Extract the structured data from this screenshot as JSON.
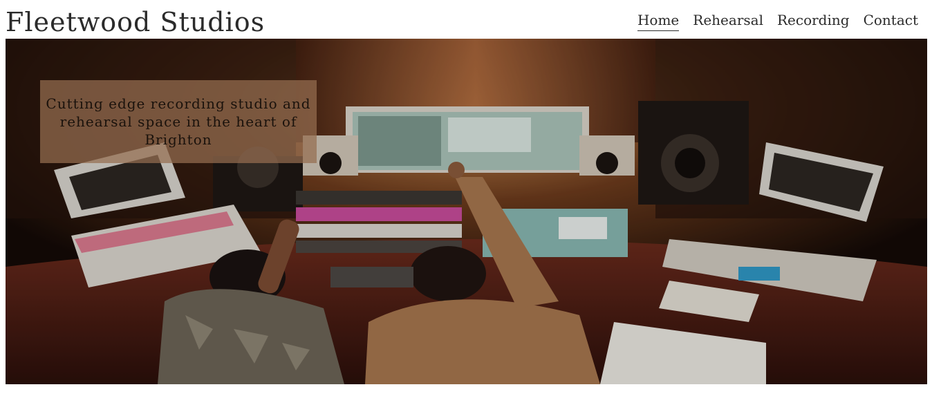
{
  "header": {
    "brand": "Fleetwood Studios",
    "nav": [
      {
        "label": "Home",
        "active": true
      },
      {
        "label": "Rehearsal",
        "active": false
      },
      {
        "label": "Recording",
        "active": false
      },
      {
        "label": "Contact",
        "active": false
      }
    ]
  },
  "hero": {
    "caption": "Cutting edge recording studio and rehearsal space in the heart of Brighton",
    "image_subject": "two-engineers-at-studio-mixing-console"
  },
  "colors": {
    "text": "#2b2b2b",
    "caption_bg": "#966e50",
    "hero_dark": "#1a0f0a"
  }
}
